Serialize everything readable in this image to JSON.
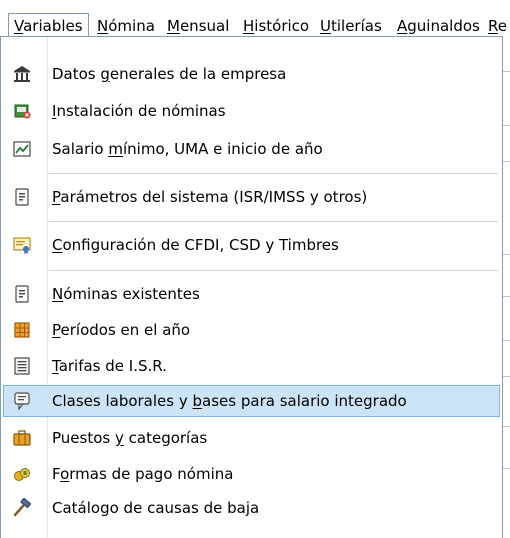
{
  "menubar": {
    "items": [
      {
        "pre": "",
        "ul": "V",
        "post": "ariables"
      },
      {
        "pre": "",
        "ul": "N",
        "post": "ómina"
      },
      {
        "pre": "",
        "ul": "M",
        "post": "ensual"
      },
      {
        "pre": "",
        "ul": "H",
        "post": "istórico"
      },
      {
        "pre": "",
        "ul": "U",
        "post": "tilerías"
      },
      {
        "pre": "",
        "ul": "A",
        "post": "guinaldos"
      },
      {
        "pre": "",
        "ul": "R",
        "post": "e"
      }
    ]
  },
  "menu": {
    "items": [
      {
        "pre": "Datos ",
        "ul": "g",
        "post": "enerales de la empresa",
        "icon": "bank-building-icon"
      },
      {
        "pre": "",
        "ul": "I",
        "post": "nstalación de nóminas",
        "icon": "installer-icon"
      },
      {
        "pre": "Salario ",
        "ul": "m",
        "post": "ínimo, UMA e inicio de año",
        "icon": "line-chart-icon"
      },
      {
        "pre": "",
        "ul": "P",
        "post": "arámetros del sistema (ISR/IMSS y otros)",
        "icon": "document-icon"
      },
      {
        "pre": "",
        "ul": "C",
        "post": "onfiguración de CFDI, CSD y Timbres",
        "icon": "certificate-icon"
      },
      {
        "pre": "",
        "ul": "N",
        "post": "óminas existentes",
        "icon": "document-icon"
      },
      {
        "pre": "",
        "ul": "P",
        "post": "eríodos en el año",
        "icon": "calendar-grid-icon"
      },
      {
        "pre": "",
        "ul": "T",
        "post": "arifas de I.S.R.",
        "icon": "list-document-icon"
      },
      {
        "pre": "Clases laborales y ",
        "ul": "b",
        "post": "ases para salario integrado",
        "icon": "speech-bubble-icon"
      },
      {
        "pre": "Puestos ",
        "ul": "y",
        "post": " categorías",
        "icon": "briefcase-icon"
      },
      {
        "pre": "F",
        "ul": "o",
        "post": "rmas de pago nómina",
        "icon": "coins-icon"
      },
      {
        "pre": "Catálogo  de causas de baja",
        "ul": "",
        "post": "",
        "icon": "hammer-icon"
      }
    ]
  },
  "colors": {
    "highlight": "#cce4f7",
    "highlight_border": "#7fb4e0",
    "menu_border": "#7f9db9"
  }
}
